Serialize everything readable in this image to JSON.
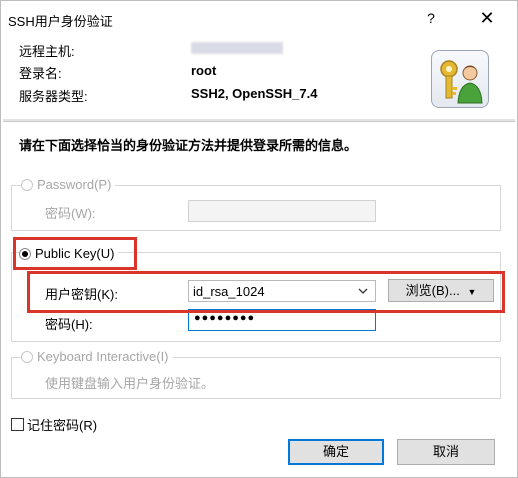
{
  "window": {
    "title": "SSH用户身份验证",
    "help_label": "?",
    "close_label": "✕"
  },
  "info": {
    "remote_host_label": "远程主机:",
    "remote_host_value": "",
    "login_label": "登录名:",
    "login_value": "root",
    "server_type_label": "服务器类型:",
    "server_type_value": "SSH2, OpenSSH_7.4"
  },
  "instruction": "请在下面选择恰当的身份验证方法并提供登录所需的信息。",
  "password_section": {
    "radio_label": "Password(P)",
    "selected": false,
    "password_label": "密码(W):",
    "password_value": ""
  },
  "publickey_section": {
    "radio_label": "Public Key(U)",
    "selected": true,
    "user_key_label": "用户密钥(K):",
    "user_key_value": "id_rsa_1024",
    "browse_label": "浏览(B)...",
    "passphrase_label": "密码(H):",
    "passphrase_value": "●●●●●●●●"
  },
  "keyboard_section": {
    "radio_label": "Keyboard Interactive(I)",
    "selected": false,
    "description": "使用键盘输入用户身份验证。"
  },
  "remember": {
    "label": "记住密码(R)",
    "checked": false
  },
  "buttons": {
    "ok": "确定",
    "cancel": "取消"
  },
  "colors": {
    "highlight_box": "#d9352b",
    "focus_accent": "#0078d7"
  },
  "icons": {
    "keys_user": "keys-user-icon",
    "chevron": "chevron-down-icon"
  }
}
